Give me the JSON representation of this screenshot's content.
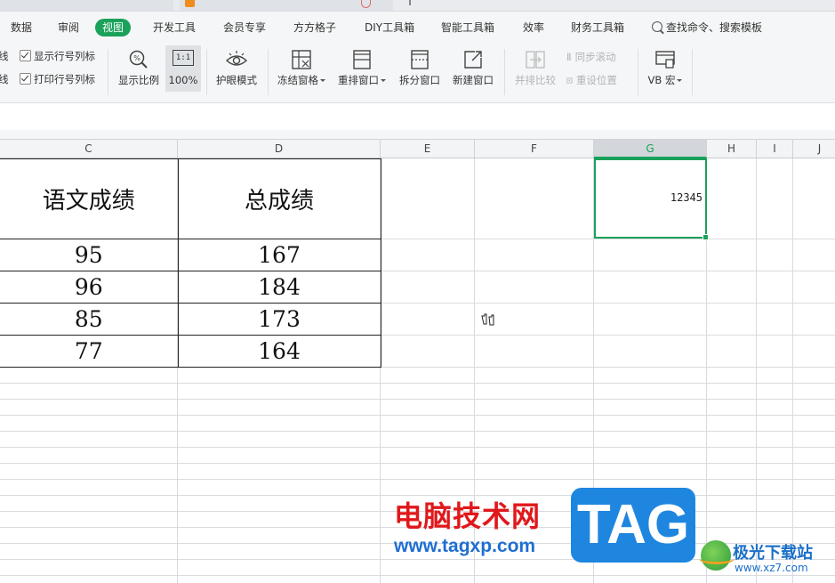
{
  "menu": {
    "items": [
      "数据",
      "审阅",
      "视图",
      "开发工具",
      "会员专享",
      "方方格子",
      "DIY工具箱",
      "智能工具箱",
      "效率",
      "财务工具箱"
    ],
    "active": "视图",
    "search": "查找命令、搜索模板"
  },
  "toolbar": {
    "gridline_partial": "线",
    "print_gridline_partial": "线",
    "show_row_col": "显示行号列标",
    "print_row_col": "打印行号列标",
    "zoom": "显示比例",
    "zoom_100": "100%",
    "eye_mode": "护眼模式",
    "freeze": "冻结窗格",
    "rearrange": "重排窗口",
    "split": "拆分窗口",
    "new_window": "新建窗口",
    "compare": "并排比较",
    "sync_scroll": "同步滚动",
    "reset_pos": "重设位置",
    "vb_macro": "VB 宏",
    "zoom_icon_text": "1:1"
  },
  "columns": [
    "C",
    "D",
    "E",
    "F",
    "G",
    "H",
    "I",
    "J"
  ],
  "selected_column": "G",
  "table": {
    "headers": [
      "语文成绩",
      "总成绩"
    ],
    "rows": [
      [
        "95",
        "167"
      ],
      [
        "96",
        "184"
      ],
      [
        "85",
        "173"
      ],
      [
        "77",
        "164"
      ]
    ]
  },
  "selected_cell_value": "12345",
  "watermark": {
    "title": "电脑技术网",
    "url": "www.tagxp.com",
    "tag": "TAG",
    "site_name": "极光下载站",
    "site_url": "www.xz7.com"
  },
  "colors": {
    "accent": "#1aa15a",
    "watermark_red": "#e0181b",
    "watermark_blue": "#1f86e0"
  }
}
